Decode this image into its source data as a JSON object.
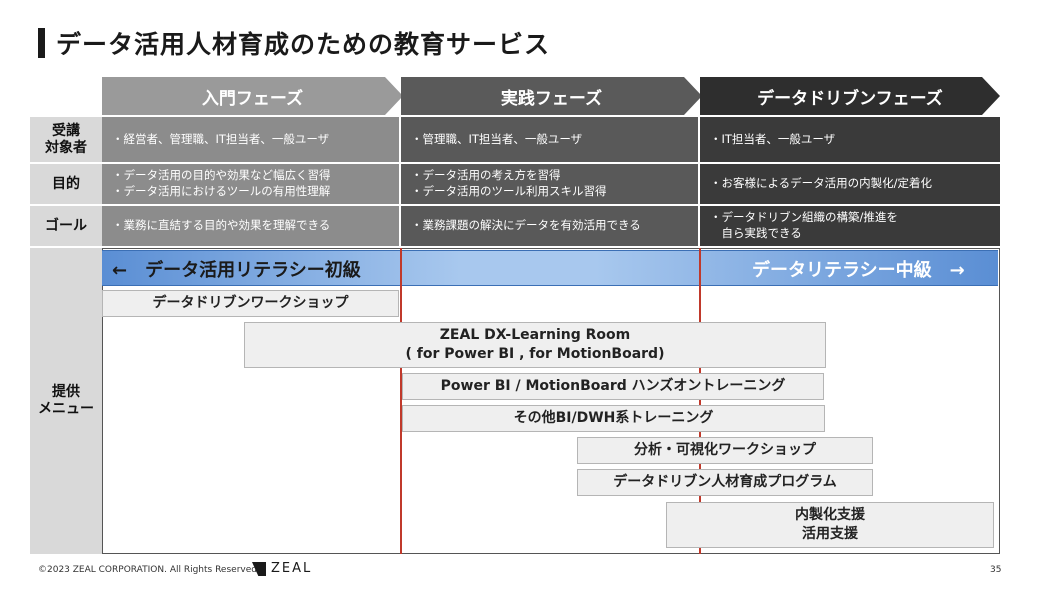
{
  "title": "データ活用人材育成のための教育サービス",
  "phases": [
    "入門フェーズ",
    "実践フェーズ",
    "データドリブンフェーズ"
  ],
  "rows": [
    {
      "label": "受講\n対象者",
      "cells": [
        [
          "・経営者、管理職、IT担当者、一般ユーザ"
        ],
        [
          "・管理職、IT担当者、一般ユーザ"
        ],
        [
          "・IT担当者、一般ユーザ"
        ]
      ]
    },
    {
      "label": "目的",
      "cells": [
        [
          "・データ活用の目的や効果など幅広く習得",
          "・データ活用におけるツールの有用性理解"
        ],
        [
          "・データ活用の考え方を習得",
          "・データ活用のツール利用スキル習得"
        ],
        [
          "・お客様によるデータ活用の内製化/定着化"
        ]
      ]
    },
    {
      "label": "ゴール",
      "cells": [
        [
          "・業務に直結する目的や効果を理解できる"
        ],
        [
          "・業務課題の解決にデータを有効活用できる"
        ],
        [
          "・データドリブン組織の構築/推進を",
          "　自ら実践できる"
        ]
      ]
    }
  ],
  "menu_label": "提供\nメニュー",
  "literacy": {
    "left": "←　データ活用リテラシー初級",
    "right": "データリテラシー中級　→"
  },
  "menu_items": [
    [
      "データドリブンワークショップ"
    ],
    [
      "ZEAL DX-Learning Room",
      "( for Power BI , for MotionBoard)"
    ],
    [
      "Power BI / MotionBoard ハンズオントレーニング"
    ],
    [
      "その他BI/DWH系トレーニング"
    ],
    [
      "分析・可視化ワークショップ"
    ],
    [
      "データドリブン人材育成プログラム"
    ],
    [
      "内製化支援",
      "活用支援"
    ]
  ],
  "footer": {
    "copyright": "©2023 ZEAL CORPORATION. All Rights Reserved.",
    "logo": "ZEAL",
    "page": "35"
  }
}
